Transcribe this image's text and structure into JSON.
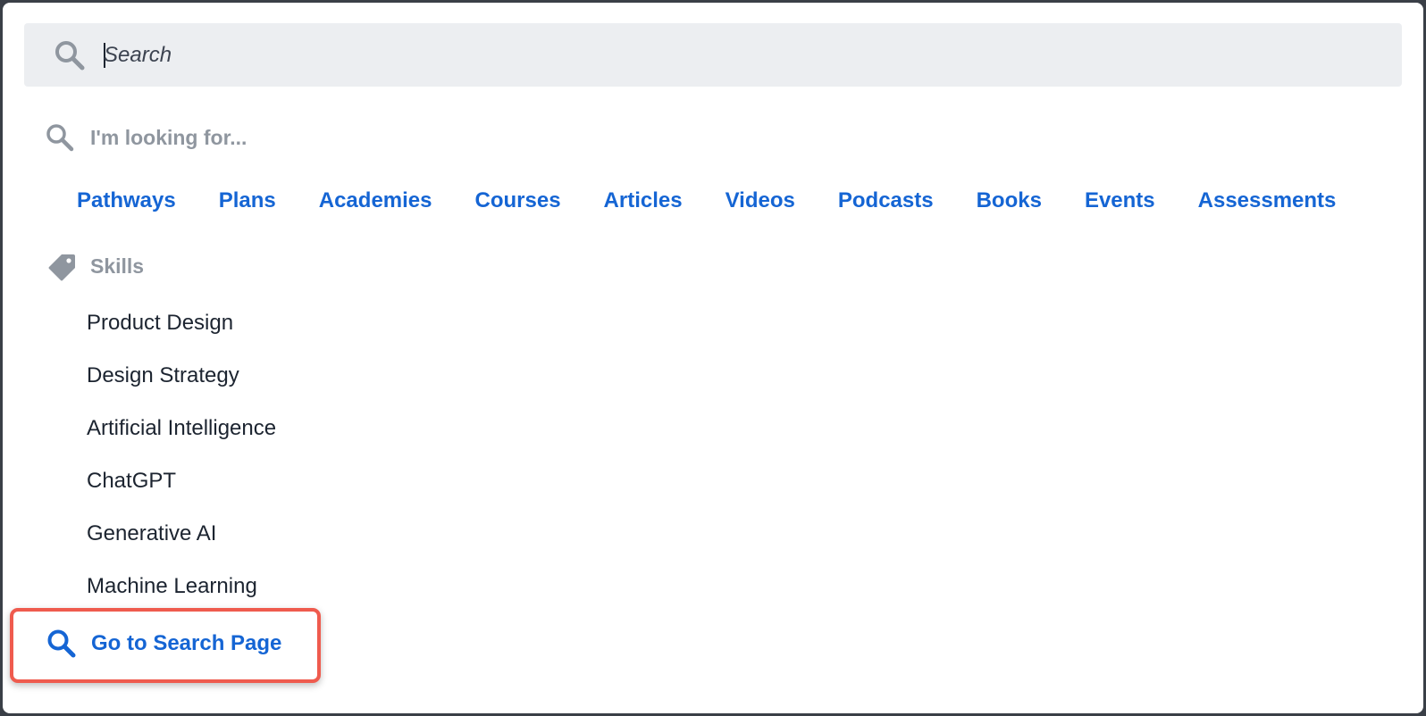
{
  "search": {
    "placeholder": "Search",
    "value": ""
  },
  "looking_for": {
    "label": "I'm looking for..."
  },
  "content_types": [
    {
      "label": "Pathways"
    },
    {
      "label": "Plans"
    },
    {
      "label": "Academies"
    },
    {
      "label": "Courses"
    },
    {
      "label": "Articles"
    },
    {
      "label": "Videos"
    },
    {
      "label": "Podcasts"
    },
    {
      "label": "Books"
    },
    {
      "label": "Events"
    },
    {
      "label": "Assessments"
    }
  ],
  "skills": {
    "heading": "Skills",
    "items": [
      {
        "label": "Product Design"
      },
      {
        "label": "Design Strategy"
      },
      {
        "label": "Artificial Intelligence"
      },
      {
        "label": "ChatGPT"
      },
      {
        "label": "Generative AI"
      },
      {
        "label": "Machine Learning"
      }
    ]
  },
  "go_to_search": {
    "label": "Go to Search Page"
  },
  "colors": {
    "link": "#1565d4",
    "muted": "#8f969f",
    "text": "#1c2430",
    "highlight": "#ef5b4e"
  },
  "icons": {
    "search": "search-icon",
    "tag": "tag-icon"
  }
}
